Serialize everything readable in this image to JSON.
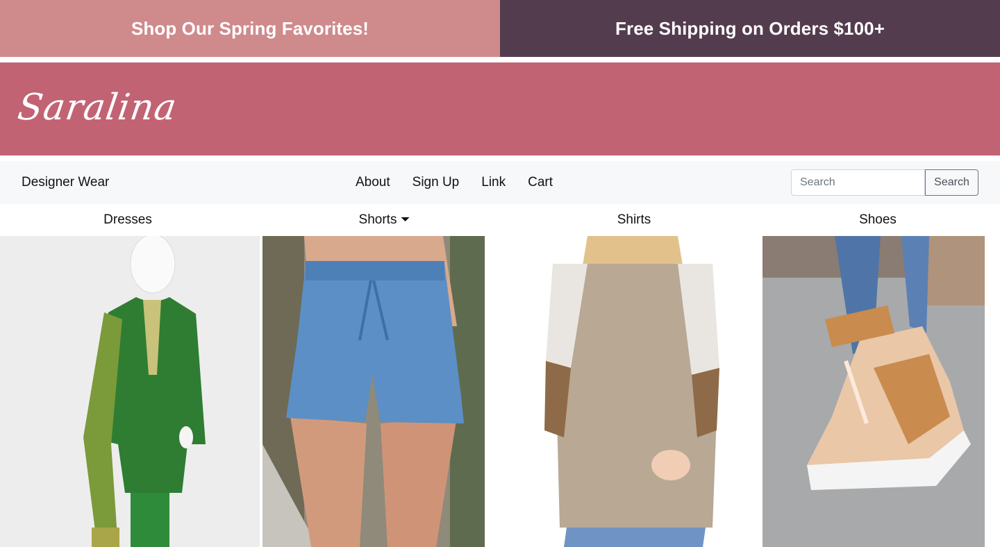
{
  "promo": {
    "left_text": "Shop Our Spring Favorites!",
    "right_text": "Free Shipping on Orders $100+"
  },
  "brand": {
    "logo_text": "Saralina"
  },
  "navbar": {
    "brand": "Designer Wear",
    "links": [
      "About",
      "Sign Up",
      "Link",
      "Cart"
    ],
    "search": {
      "placeholder": "Search",
      "value": "",
      "button_label": "Search"
    }
  },
  "categories": [
    "Dresses",
    "Shorts",
    "Shirts",
    "Shoes"
  ],
  "colors": {
    "promo_left": "#cf8a8c",
    "promo_right": "#543c4f",
    "brand_bar": "#c26374",
    "navbar_bg": "#f7f8fa"
  }
}
